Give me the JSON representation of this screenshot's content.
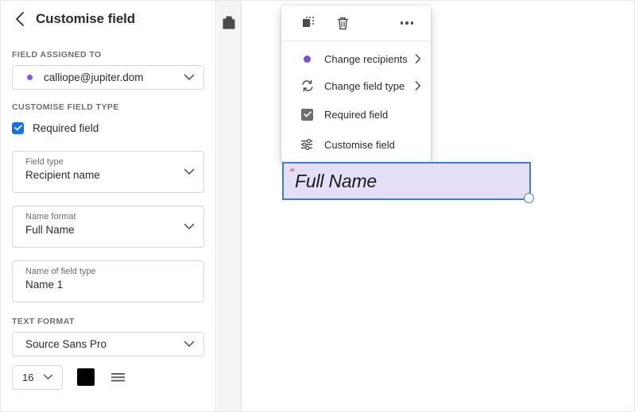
{
  "sidebar": {
    "back_icon": "chevron-left-icon",
    "title": "Customise field",
    "sections": {
      "assigned_label": "FIELD ASSIGNED TO",
      "assigned_value": "calliope@jupiter.dom",
      "assigned_dot_color": "#8257E5",
      "customise_label": "CUSTOMISE FIELD TYPE",
      "text_format_label": "TEXT FORMAT"
    },
    "required_checkbox": {
      "label": "Required field",
      "checked": true,
      "color": "#1473E6"
    },
    "fields": [
      {
        "label": "Field type",
        "value": "Recipient name",
        "has_chevron": true
      },
      {
        "label": "Name format",
        "value": "Full Name",
        "has_chevron": true
      },
      {
        "label": "Name of field type",
        "value": "Name 1",
        "has_chevron": false
      }
    ],
    "font_family": "Source Sans Pro",
    "font_size": "16",
    "font_color": "#000000",
    "align_icon": "align-justify-icon"
  },
  "mid_toolbar": {
    "copy_icon": "duplicate-document-icon"
  },
  "canvas": {
    "popup": {
      "toolbar": [
        {
          "icon": "duplicate-selection-icon",
          "name": "duplicate-button"
        },
        {
          "icon": "trash-icon",
          "name": "delete-button"
        },
        {
          "icon": "more-options-icon",
          "name": "more-options-button"
        }
      ],
      "items": [
        {
          "label": "Change recipients",
          "icon": "purple-dot-icon",
          "has_submenu": true
        },
        {
          "label": "Change field type",
          "icon": "refresh-icon",
          "has_submenu": true
        },
        {
          "label": "Required field",
          "icon": "checkbox-checked-icon",
          "has_submenu": false
        },
        {
          "label": "Customise field",
          "icon": "sliders-icon",
          "has_submenu": false
        }
      ],
      "accent_purple": "#7B4DE0"
    },
    "form_field": {
      "required_marker": "*",
      "placeholder": "Full Name",
      "fill_color": "#E4DEF7",
      "border_color": "#3B7FD4"
    }
  }
}
